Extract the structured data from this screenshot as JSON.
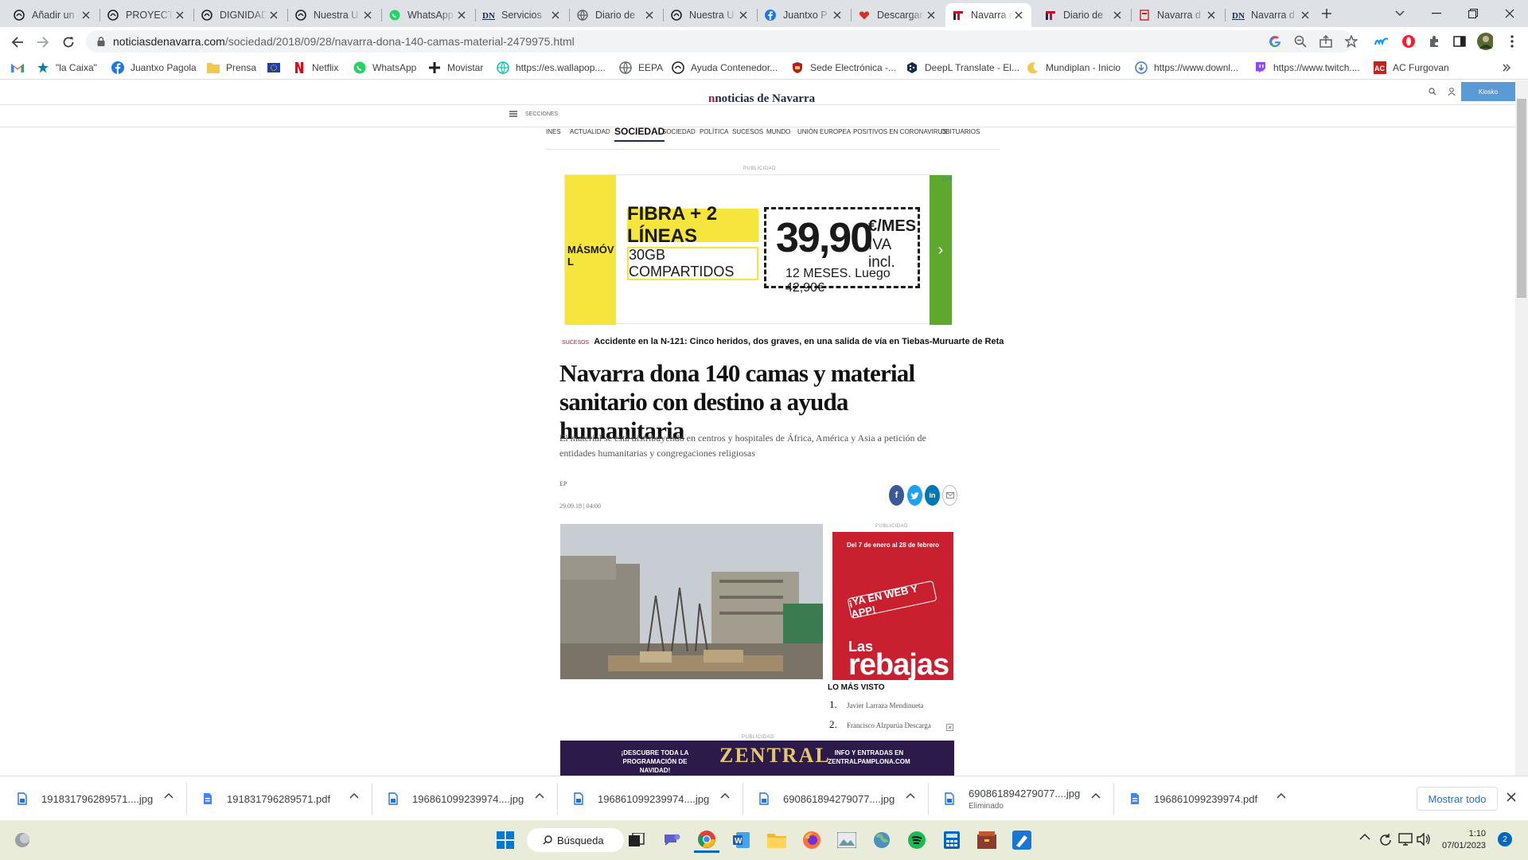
{
  "browser": {
    "tabs": [
      {
        "title": "Añadir un",
        "icon": "circle-logo-icon"
      },
      {
        "title": "PROYECTO",
        "icon": "circle-logo-icon"
      },
      {
        "title": "DIGNIDAD",
        "icon": "circle-logo-icon"
      },
      {
        "title": "Nuestra U",
        "icon": "circle-logo-icon"
      },
      {
        "title": "WhatsApp",
        "icon": "whatsapp-icon"
      },
      {
        "title": "Servicios",
        "icon": "dn-logo-icon"
      },
      {
        "title": "Diario de",
        "icon": "globe-icon"
      },
      {
        "title": "Nuestra U",
        "icon": "circle-logo-icon"
      },
      {
        "title": "Juantxo P",
        "icon": "facebook-icon"
      },
      {
        "title": "Descargar",
        "icon": "heart-icon"
      },
      {
        "title": "Navarra d",
        "icon": "n-logo-icon",
        "active": true
      },
      {
        "title": "Diario de",
        "icon": "n-logo-icon"
      },
      {
        "title": "Navarra d",
        "icon": "document-icon"
      },
      {
        "title": "Navarra d",
        "icon": "dn-logo-icon"
      }
    ],
    "url_domain": "noticiasdenavarra.com",
    "url_path": "/sociedad/2018/09/28/navarra-dona-140-camas-material-2479975.html",
    "bookmarks": [
      {
        "label": "",
        "icon": "gmail-icon"
      },
      {
        "label": "\"la Caixa\"",
        "icon": "star-icon"
      },
      {
        "label": "Juantxo Pagola",
        "icon": "facebook-icon"
      },
      {
        "label": "Prensa",
        "icon": "folder-icon"
      },
      {
        "label": "",
        "icon": "eu-flag-icon"
      },
      {
        "label": "Netflix",
        "icon": "netflix-icon"
      },
      {
        "label": "WhatsApp",
        "icon": "whatsapp-icon"
      },
      {
        "label": "Movistar",
        "icon": "plus-icon"
      },
      {
        "label": "https://es.wallapop....",
        "icon": "globe-icon"
      },
      {
        "label": "EEPA",
        "icon": "globe-icon"
      },
      {
        "label": "Ayuda Contenedor...",
        "icon": "circle-logo-icon"
      },
      {
        "label": "Sede Electrónica -...",
        "icon": "shield-icon"
      },
      {
        "label": "DeepL Translate - El...",
        "icon": "deepl-icon"
      },
      {
        "label": "Mundiplan - Inicio",
        "icon": "moon-icon"
      },
      {
        "label": "https://www.downl...",
        "icon": "download-icon"
      },
      {
        "label": "https://www.twitch....",
        "icon": "twitch-icon"
      },
      {
        "label": "AC Furgovan",
        "icon": "ac-icon"
      }
    ]
  },
  "site": {
    "logo": "noticias de Navarra",
    "kiosko": "Kiosko",
    "secciones": "SECCIONES",
    "nav": [
      "INES",
      "ACTUALIDAD",
      "SOCIEDAD",
      "SOCIEDAD",
      "POLÍTICA",
      "SUCESOS",
      "MUNDO",
      "UNIÓN EUROPEA",
      "POSITIVOS EN CORONAVIRUS",
      "OBITUARIOS"
    ],
    "publicidad": "PUBLICIDAD"
  },
  "ad_top": {
    "brand": "MÁSMÓV L",
    "fibra": "FIBRA + 2 LÍNEAS",
    "gb": "30GB COMPARTIDOS",
    "price": "39,90",
    "per_month": "€/MES",
    "iva": "IVA incl.",
    "terms": "12 MESES. Luego 42,90€"
  },
  "article": {
    "related_category": "SUCESOS",
    "related_title": "Accidente en la N-121: Cinco heridos, dos graves, en una salida de vía en Tiebas-Muruarte de Reta",
    "headline": "Navarra dona 140 camas y material sanitario con destino a ayuda humanitaria",
    "subtitle": "El material se está distribuyendo en centros y hospitales de África, América y Asia a petición de entidades humanitarias y congregaciones religiosas",
    "author": "EP",
    "date": "29.09.18 | 04:00"
  },
  "sidebar": {
    "ad_dates": "Del 7 de enero al 28 de febrero",
    "ad_pill": "¡YA EN WEB Y APP!",
    "ad_las": "Las",
    "ad_rebajas": "rebajas",
    "most_viewed_title": "LO MÁS VISTO",
    "most_viewed": [
      {
        "n": "1.",
        "text": "Javier Larraza Mendinueta"
      },
      {
        "n": "2.",
        "text": "Francisco Alzpurúa Descarga"
      }
    ]
  },
  "ad_bottom": {
    "left": "¡DESCUBRE TODA LA PROGRAMACIÓN DE NAVIDAD!",
    "middle": "ZENTRAL",
    "right": "INFO Y ENTRADAS EN ZENTRALPAMPLONA.COM"
  },
  "downloads": {
    "items": [
      {
        "name": "191831796289571....jpg",
        "type": "image"
      },
      {
        "name": "191831796289571.pdf",
        "type": "pdf"
      },
      {
        "name": "196861099239974....jpg",
        "type": "image"
      },
      {
        "name": "196861099239974....jpg",
        "type": "image"
      },
      {
        "name": "690861894279077....jpg",
        "type": "image"
      },
      {
        "name": "690861894279077....jpg",
        "type": "image",
        "status": "Eliminado"
      },
      {
        "name": "196861099239974.pdf",
        "type": "pdf"
      }
    ],
    "show_all": "Mostrar todo"
  },
  "taskbar": {
    "search": "Búsqueda",
    "time": "1:10",
    "date": "07/01/2023",
    "notification_count": "2"
  },
  "colors": {
    "brand_red": "#c8102e",
    "brand_navy": "#1c2a4a",
    "ad_yellow": "#f5e53c",
    "ad_green": "#5fa82e"
  }
}
